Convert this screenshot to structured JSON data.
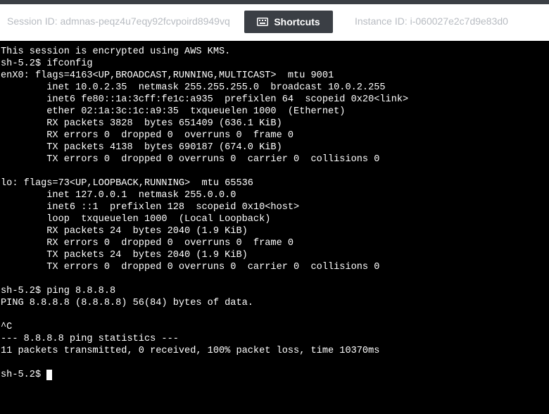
{
  "header": {
    "session_id": "Session ID: admnas-peqz4u7eqy92fcvpoird8949vq",
    "shortcuts_label": "Shortcuts",
    "instance_id": "Instance ID: i-060027e2c7d9e83d0"
  },
  "terminal": {
    "lines": [
      "This session is encrypted using AWS KMS.",
      "sh-5.2$ ifconfig",
      "enX0: flags=4163<UP,BROADCAST,RUNNING,MULTICAST>  mtu 9001",
      "        inet 10.0.2.35  netmask 255.255.255.0  broadcast 10.0.2.255",
      "        inet6 fe80::1a:3cff:fe1c:a935  prefixlen 64  scopeid 0x20<link>",
      "        ether 02:1a:3c:1c:a9:35  txqueuelen 1000  (Ethernet)",
      "        RX packets 3828  bytes 651409 (636.1 KiB)",
      "        RX errors 0  dropped 0  overruns 0  frame 0",
      "        TX packets 4138  bytes 690187 (674.0 KiB)",
      "        TX errors 0  dropped 0 overruns 0  carrier 0  collisions 0",
      "",
      "lo: flags=73<UP,LOOPBACK,RUNNING>  mtu 65536",
      "        inet 127.0.0.1  netmask 255.0.0.0",
      "        inet6 ::1  prefixlen 128  scopeid 0x10<host>",
      "        loop  txqueuelen 1000  (Local Loopback)",
      "        RX packets 24  bytes 2040 (1.9 KiB)",
      "        RX errors 0  dropped 0  overruns 0  frame 0",
      "        TX packets 24  bytes 2040 (1.9 KiB)",
      "        TX errors 0  dropped 0 overruns 0  carrier 0  collisions 0",
      "",
      "sh-5.2$ ping 8.8.8.8",
      "PING 8.8.8.8 (8.8.8.8) 56(84) bytes of data.",
      "",
      "^C",
      "--- 8.8.8.8 ping statistics ---",
      "11 packets transmitted, 0 received, 100% packet loss, time 10370ms",
      ""
    ],
    "prompt": "sh-5.2$ "
  },
  "colors": {
    "header_bg": "#ffffff",
    "header_text": "#b8bcc2",
    "button_bg": "#3b3f45",
    "terminal_bg": "#000000",
    "terminal_fg": "#ffffff"
  },
  "icons": {
    "shortcuts": "keyboard-icon"
  }
}
